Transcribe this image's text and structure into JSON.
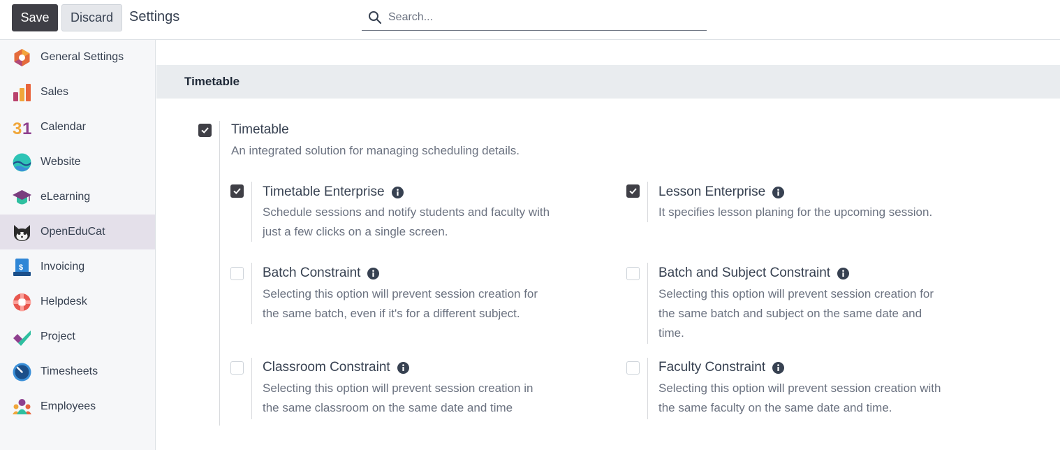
{
  "control_panel": {
    "save_label": "Save",
    "discard_label": "Discard",
    "title": "Settings",
    "search_placeholder": "Search..."
  },
  "sidebar": {
    "items": [
      {
        "label": "General Settings",
        "icon": "general-settings-icon"
      },
      {
        "label": "Sales",
        "icon": "sales-icon"
      },
      {
        "label": "Calendar",
        "icon": "calendar-icon"
      },
      {
        "label": "Website",
        "icon": "website-icon"
      },
      {
        "label": "eLearning",
        "icon": "elearning-icon"
      },
      {
        "label": "OpenEduCat",
        "icon": "openeducat-icon",
        "active": true
      },
      {
        "label": "Invoicing",
        "icon": "invoicing-icon"
      },
      {
        "label": "Helpdesk",
        "icon": "helpdesk-icon"
      },
      {
        "label": "Project",
        "icon": "project-icon"
      },
      {
        "label": "Timesheets",
        "icon": "timesheets-icon"
      },
      {
        "label": "Employees",
        "icon": "employees-icon"
      }
    ]
  },
  "section": {
    "title": "Timetable",
    "main_setting": {
      "title": "Timetable",
      "description": "An integrated solution for managing scheduling details.",
      "checked": true
    },
    "sub_settings": [
      {
        "title": "Timetable Enterprise",
        "description_lines": [
          "Schedule sessions and notify students and faculty with",
          "just a few clicks on a single screen."
        ],
        "checked": true
      },
      {
        "title": "Lesson Enterprise",
        "description_lines": [
          "It specifies lesson planing for the upcoming session."
        ],
        "checked": true
      },
      {
        "title": "Batch Constraint",
        "description_lines": [
          "Selecting this option will prevent session creation for",
          "the same batch, even if it's for a different subject."
        ],
        "checked": false
      },
      {
        "title": "Batch and Subject Constraint",
        "description_lines": [
          "Selecting this option will prevent session creation for",
          "the same batch and subject on the same date and",
          "time."
        ],
        "checked": false
      },
      {
        "title": "Classroom Constraint",
        "description_lines": [
          "Selecting this option will prevent session creation in",
          "the same classroom on the same date and time"
        ],
        "checked": false
      },
      {
        "title": "Faculty Constraint",
        "description_lines": [
          "Selecting this option will prevent session creation with",
          "the same faculty on the same date and time."
        ],
        "checked": false
      }
    ]
  },
  "colors": {
    "accent_dark": "#3f3f46",
    "sidebar_active": "#e4e0ea",
    "section_band": "#e9ecef"
  }
}
